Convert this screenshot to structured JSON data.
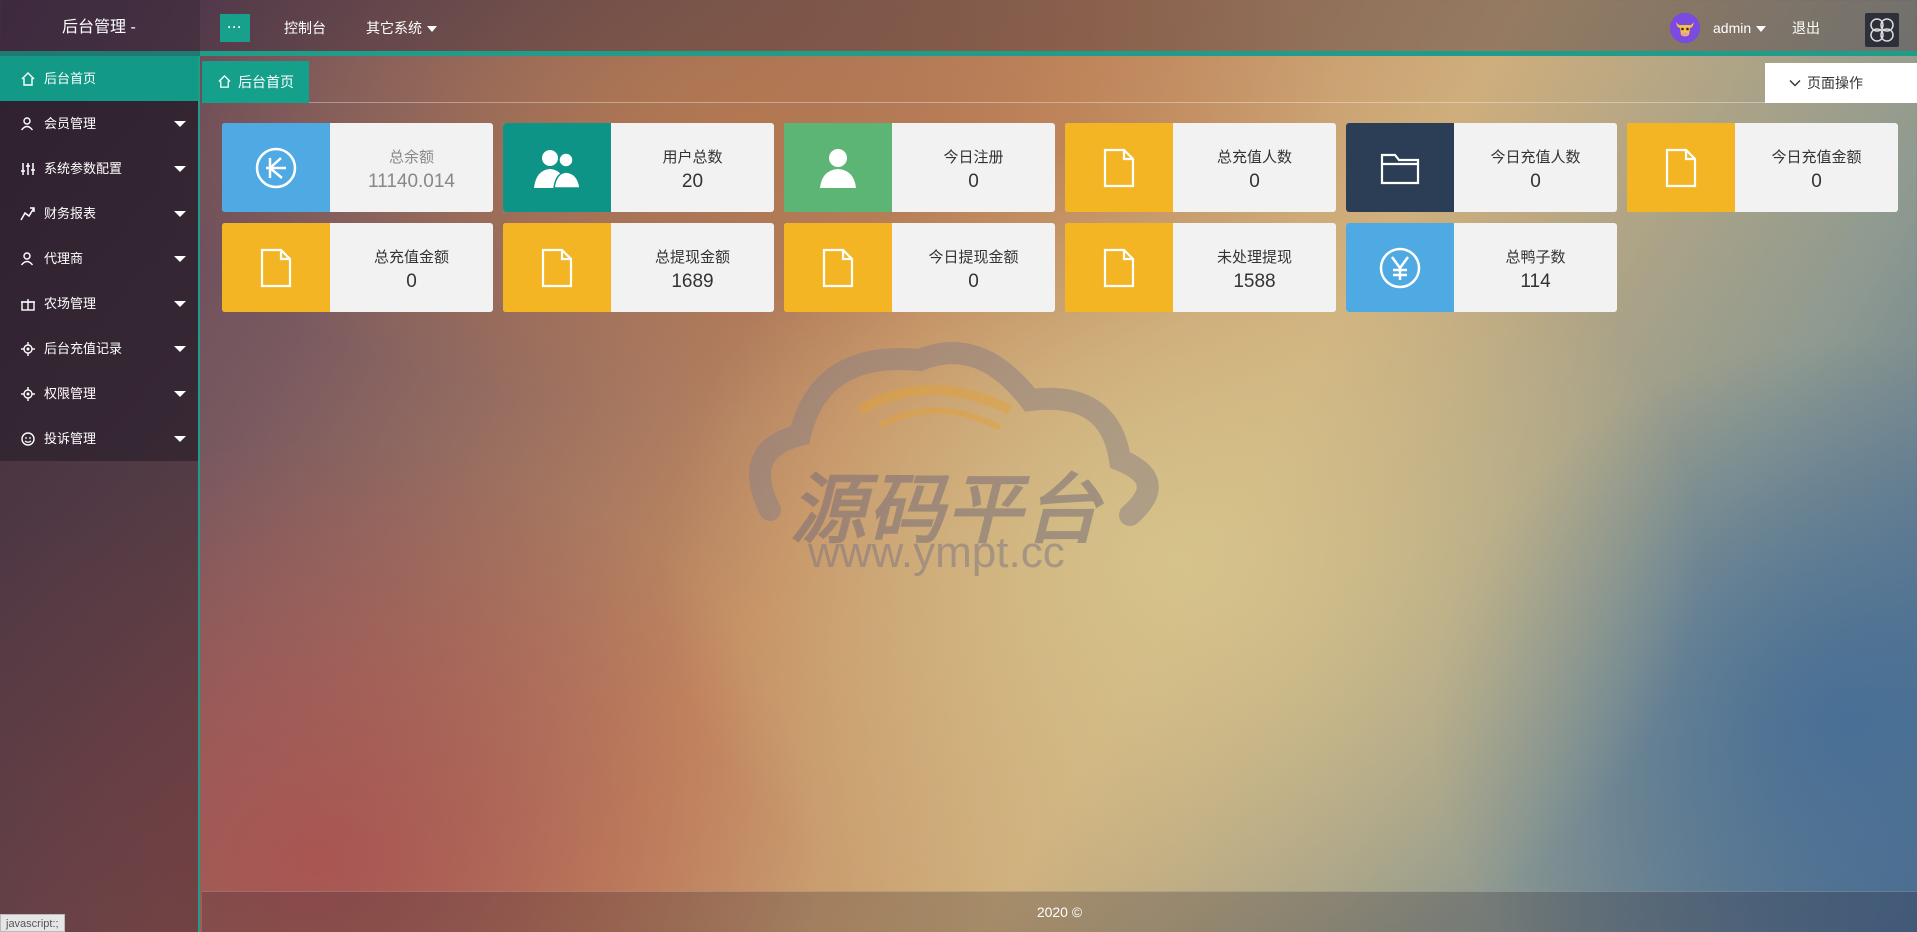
{
  "header": {
    "brand": "后台管理 -",
    "toggle_label": "···",
    "nav": [
      {
        "label": "控制台"
      },
      {
        "label": "其它系统"
      }
    ],
    "user": "admin",
    "logout": "退出"
  },
  "sidebar": {
    "items": [
      {
        "label": "后台首页",
        "icon": "home-icon",
        "active": true
      },
      {
        "label": "会员管理",
        "icon": "user-icon"
      },
      {
        "label": "系统参数配置",
        "icon": "sliders-icon"
      },
      {
        "label": "财务报表",
        "icon": "chart-icon"
      },
      {
        "label": "代理商",
        "icon": "user-icon"
      },
      {
        "label": "农场管理",
        "icon": "gift-icon"
      },
      {
        "label": "后台充值记录",
        "icon": "gear-icon"
      },
      {
        "label": "权限管理",
        "icon": "gear-icon"
      },
      {
        "label": "投诉管理",
        "icon": "smile-icon"
      }
    ]
  },
  "tabs": {
    "active": "后台首页",
    "page_ops": "页面操作"
  },
  "stats": [
    {
      "label": "总余额",
      "value": "11140.014",
      "color": "#4fa9e3",
      "icon": "currency-circle-icon"
    },
    {
      "label": "用户总数",
      "value": "20",
      "color": "#0d9487",
      "icon": "users-icon"
    },
    {
      "label": "今日注册",
      "value": "0",
      "color": "#5cb574",
      "icon": "user-icon"
    },
    {
      "label": "总充值人数",
      "value": "0",
      "color": "#f4b525",
      "icon": "file-icon"
    },
    {
      "label": "今日充值人数",
      "value": "0",
      "color": "#2c3e55",
      "icon": "folder-icon"
    },
    {
      "label": "今日充值金额",
      "value": "0",
      "color": "#f4b525",
      "icon": "file-icon"
    },
    {
      "label": "总充值金额",
      "value": "0",
      "color": "#f4b525",
      "icon": "file-icon"
    },
    {
      "label": "总提现金额",
      "value": "1689",
      "color": "#f4b525",
      "icon": "file-icon"
    },
    {
      "label": "今日提现金额",
      "value": "0",
      "color": "#f4b525",
      "icon": "file-icon"
    },
    {
      "label": "未处理提现",
      "value": "1588",
      "color": "#f4b525",
      "icon": "file-icon"
    },
    {
      "label": "总鸭子数",
      "value": "114",
      "color": "#4fa9e3",
      "icon": "yen-circle-icon"
    }
  ],
  "watermark": {
    "title": "源码平台",
    "url": "www.ympt.cc"
  },
  "footer": "2020 ©",
  "statusbar": "javascript:;"
}
